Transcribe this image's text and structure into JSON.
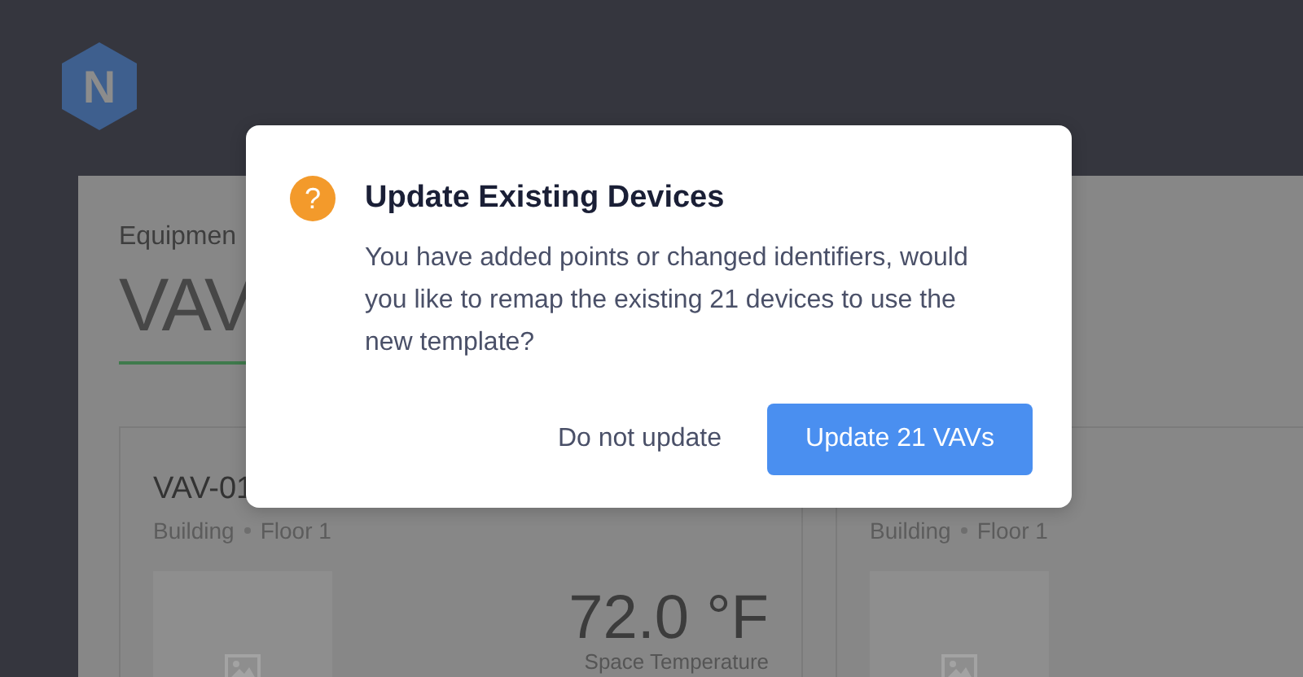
{
  "logo": {
    "letter": "N"
  },
  "page": {
    "breadcrumb": "Equipmen",
    "title": "VAV"
  },
  "cards": [
    {
      "name": "VAV-01",
      "location": [
        "Building",
        "Floor 1"
      ],
      "reading": "72.0 °F",
      "reading_label": "Space Temperature"
    },
    {
      "location": [
        "Building",
        "Floor 1"
      ]
    }
  ],
  "dialog": {
    "icon": "?",
    "title": "Update Existing Devices",
    "message": "You have added points or changed identifiers, would you like to remap the existing 21 devices to use the new template?",
    "buttons": [
      {
        "label": "Do not update",
        "kind": "secondary"
      },
      {
        "label": "Update 21 VAVs",
        "kind": "primary"
      }
    ]
  }
}
